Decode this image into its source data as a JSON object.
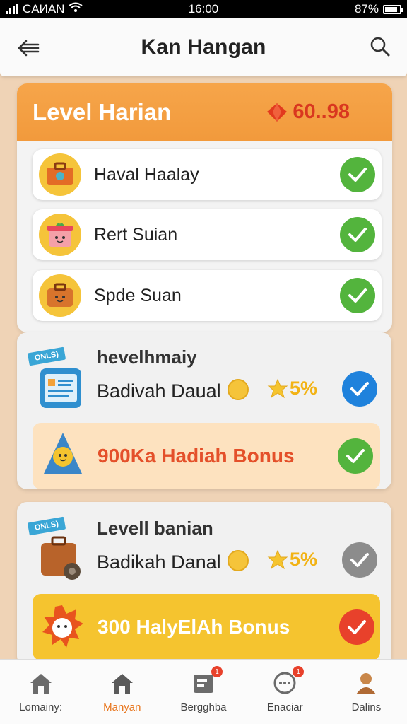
{
  "status_bar": {
    "carrier": "CAИAN",
    "time": "16:00",
    "battery": "87%",
    "battery_level": 0.87
  },
  "header": {
    "title": "Kan Hangan"
  },
  "level_card": {
    "title": "Level Harian",
    "points": "60..98",
    "tasks": [
      {
        "label": "Haval Haalay",
        "icon": "suitcase-icon",
        "status": "done"
      },
      {
        "label": "Rert Suian",
        "icon": "gift-box-icon",
        "status": "done"
      },
      {
        "label": "Spde Suan",
        "icon": "bag-icon",
        "status": "done"
      }
    ]
  },
  "reward_cards": [
    {
      "tag": "ONLS)",
      "subtitle": "hevelhmaiy",
      "label": "Badivah Daual",
      "stars": "5%",
      "check": "blue",
      "bonus": {
        "text": "900Ka Hadiah Bonus",
        "color": "#e4502a",
        "bg": "#fde2bf",
        "check": "green"
      }
    },
    {
      "tag": "ONLS)",
      "subtitle": "Levell banian",
      "label": "Badikah Danal",
      "stars": "5%",
      "check": "gray",
      "bonus": {
        "text": "300 HalyElAh Bonus",
        "color": "#fff",
        "bg": "#f5c42f",
        "check": "red"
      }
    }
  ],
  "bottom_nav": [
    {
      "label": "Lomainy:",
      "icon": "home-icon",
      "active": false
    },
    {
      "label": "Manyan",
      "icon": "home-icon",
      "active": true
    },
    {
      "label": "Bergghba",
      "icon": "message-icon",
      "badge": "1"
    },
    {
      "label": "Enaciar",
      "icon": "chat-icon",
      "badge": "1"
    },
    {
      "label": "Dalins",
      "icon": "profile-icon"
    }
  ],
  "colors": {
    "accent": "#f29a3c",
    "success": "#53b43d",
    "primary": "#1f82dc"
  }
}
